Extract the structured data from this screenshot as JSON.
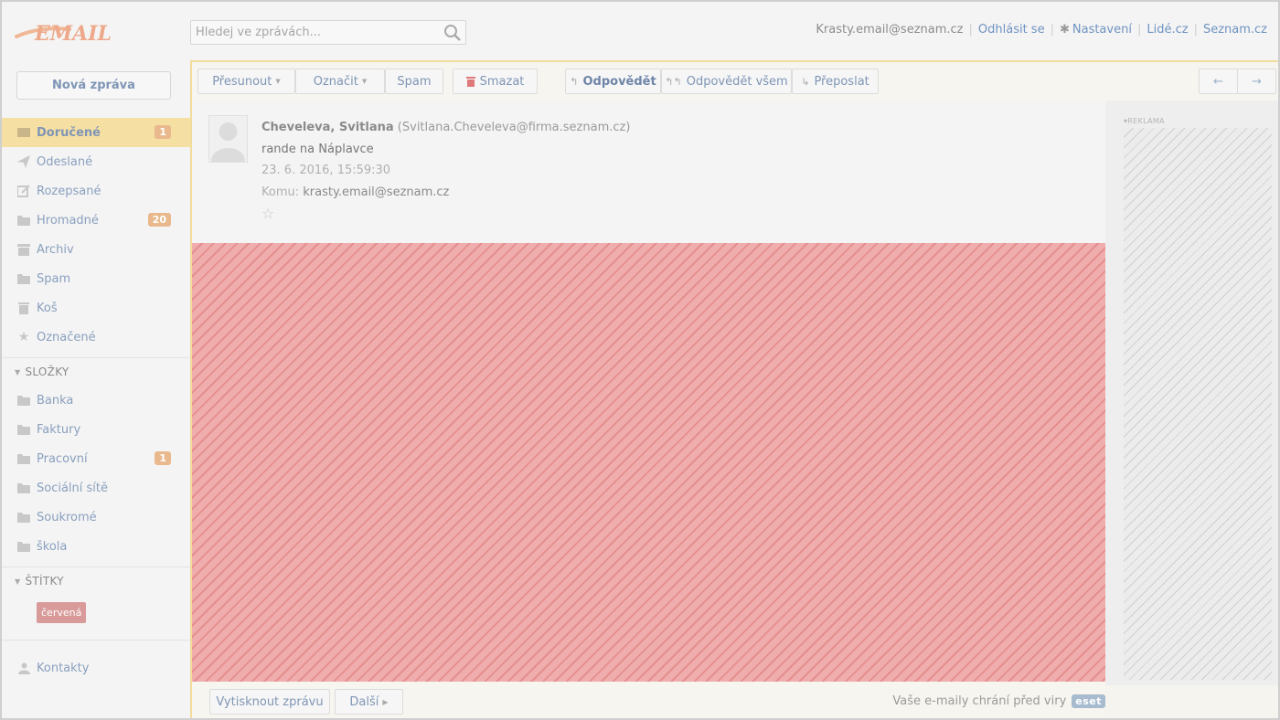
{
  "logo": {
    "text": "EMAIL"
  },
  "search": {
    "placeholder": "Hledej ve zprávách..."
  },
  "topbar": {
    "user": "Krasty.email@seznam.cz",
    "logout": "Odhlásit se",
    "settings": "Nastavení",
    "people": "Lidé.cz",
    "seznam": "Seznam.cz"
  },
  "sidebar": {
    "new_message": "Nová zpráva",
    "items": [
      {
        "label": "Doručené",
        "icon": "inbox-icon",
        "badge": "1",
        "active": true
      },
      {
        "label": "Odeslané",
        "icon": "send-icon"
      },
      {
        "label": "Rozepsané",
        "icon": "edit-icon"
      },
      {
        "label": "Hromadné",
        "icon": "folder-icon",
        "badge": "20"
      },
      {
        "label": "Archiv",
        "icon": "archive-icon"
      },
      {
        "label": "Spam",
        "icon": "folder-icon"
      },
      {
        "label": "Koš",
        "icon": "trash-icon"
      },
      {
        "label": "Označené",
        "icon": "star-icon"
      }
    ],
    "folders_heading": "SLOŽKY",
    "folders": [
      {
        "label": "Banka"
      },
      {
        "label": "Faktury"
      },
      {
        "label": "Pracovní",
        "badge": "1"
      },
      {
        "label": "Sociální sítě"
      },
      {
        "label": "Soukromé"
      },
      {
        "label": "škola"
      }
    ],
    "tags_heading": "ŠTÍTKY",
    "tags": [
      "červená"
    ],
    "contacts": "Kontakty"
  },
  "toolbar": {
    "move": "Přesunout",
    "mark": "Označit",
    "spam": "Spam",
    "delete": "Smazat",
    "reply": "Odpovědět",
    "reply_all": "Odpovědět všem",
    "forward": "Přeposlat"
  },
  "message": {
    "sender_name": "Cheveleva, Svitlana",
    "sender_email": "(Svitlana.Cheveleva@firma.seznam.cz)",
    "subject": "rande na Náplavce",
    "date": "23. 6. 2016, 15:59:30",
    "to_label": "Komu:",
    "to": "krasty.email@seznam.cz"
  },
  "ad": {
    "label": "REKLAMA"
  },
  "footer": {
    "print": "Vytisknout zprávu",
    "more": "Další",
    "virus_text": "Vaše e-maily chrání před viry",
    "eset": "eset"
  },
  "colors": {
    "accent_link": "#6f93c2",
    "active_item": "#f6dfa3",
    "badge": "#e9b98d",
    "tag_red": "#d99a9a",
    "body_placeholder": "#efadad"
  }
}
